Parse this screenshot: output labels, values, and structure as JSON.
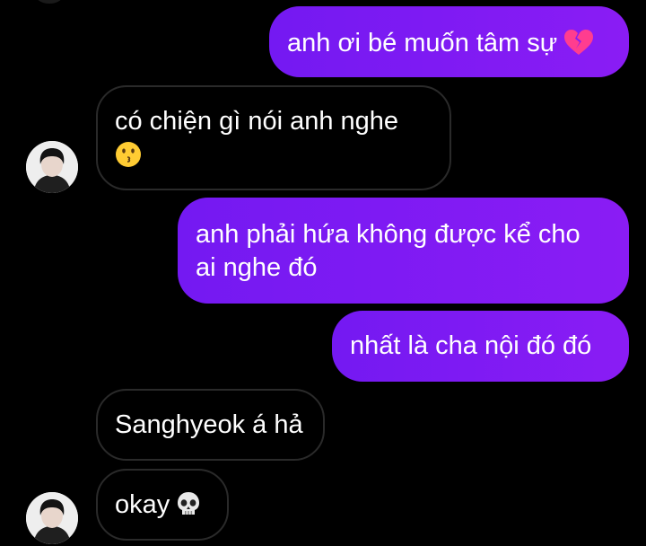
{
  "messages": [
    {
      "side": "sent",
      "text": "anh ơi bé muốn tâm sự",
      "emoji": "broken-heart"
    },
    {
      "side": "received",
      "text": "có chiện gì nói anh nghe",
      "emoji": "kissing-face"
    },
    {
      "side": "sent",
      "line1": "anh phải hứa không được kể cho",
      "line2": "ai nghe đó"
    },
    {
      "side": "sent",
      "text": "nhất là cha nội đó đó"
    },
    {
      "side": "received",
      "text": "Sanghyeok á hả"
    },
    {
      "side": "received",
      "text": "okay",
      "emoji": "skull"
    }
  ],
  "colors": {
    "background": "#000000",
    "sent_bubble": "#7e1af3",
    "received_border": "#2a2a2a",
    "text": "#ffffff"
  }
}
